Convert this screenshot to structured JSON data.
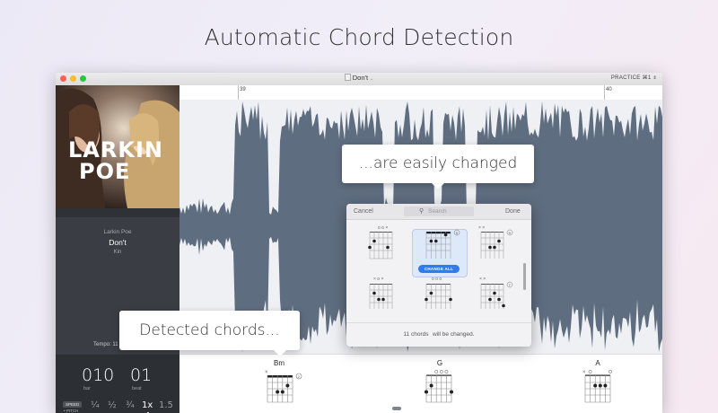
{
  "headline": "Automatic Chord Detection",
  "window": {
    "title": "Don't",
    "practice_label": "PRACTICE ⌘1"
  },
  "album": {
    "cover_text_line1": "LARKIN",
    "cover_text_line2": "POE",
    "artist": "Larkin Poe",
    "song": "Don't",
    "album_name": "Kin"
  },
  "sidebar": {
    "tempo_label": "Tempo: 11",
    "bar_value": "010",
    "bar_label": "bar",
    "beat_value": "01",
    "beat_label": "beat",
    "speed_label": "SPEED",
    "pitch_label": "• PITCH",
    "speed_options": [
      "¼",
      "½",
      "¾",
      "1x",
      "1.5"
    ],
    "selected_speed": "1x"
  },
  "timeline": {
    "markers": [
      "39",
      "40"
    ]
  },
  "chords": {
    "lane": [
      "Bm",
      "G",
      "A"
    ]
  },
  "callouts": {
    "changed": "...are easily changed",
    "detected": "Detected chords..."
  },
  "picker": {
    "cancel_label": "Cancel",
    "search_placeholder": "Search",
    "done_label": "Done",
    "change_all_label": "CHANGE ALL",
    "footer_count": "11 chords",
    "footer_rest": "will be changed."
  },
  "colors": {
    "waveform": "#5f6d80",
    "accent": "#2f7cf0",
    "sidebar_bg": "#3a3d43"
  }
}
